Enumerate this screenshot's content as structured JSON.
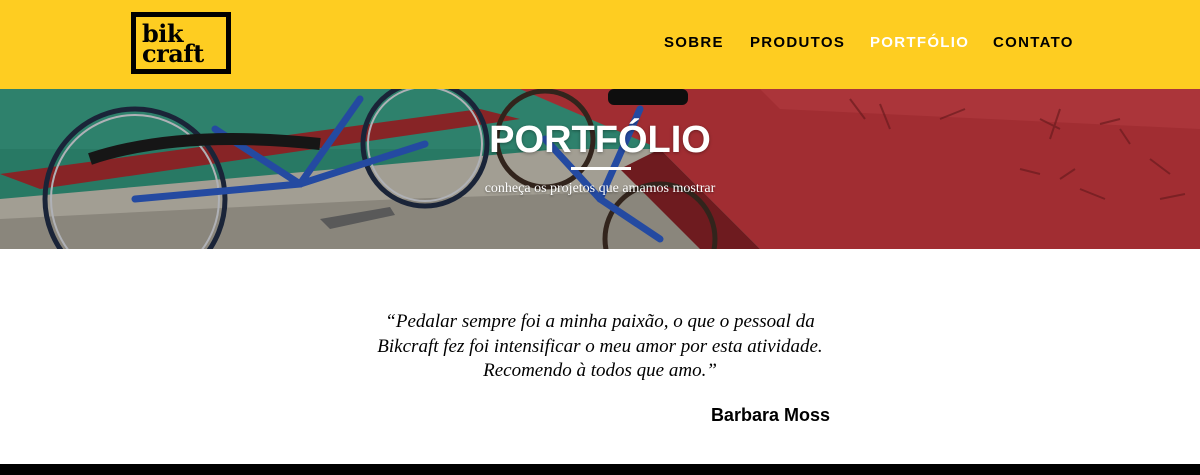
{
  "logo": {
    "line1": "bik",
    "line2": "craft"
  },
  "nav": {
    "items": [
      {
        "label": "SOBRE",
        "active": false
      },
      {
        "label": "PRODUTOS",
        "active": false
      },
      {
        "label": "PORTFÓLIO",
        "active": true
      },
      {
        "label": "CONTATO",
        "active": false
      }
    ]
  },
  "hero": {
    "title": "PORTFÓLIO",
    "subtitle": "conheça os projetos que amamos mostrar",
    "background_icon": "bicycles-on-pier-photo"
  },
  "testimonial": {
    "quote": "“Pedalar sempre foi a minha paixão, o que o pessoal da Bikcraft fez foi intensificar o meu amor por esta atividade. Recomendo à todos que amo.”",
    "author": "Barbara Moss"
  },
  "colors": {
    "brand_yellow": "#fecd21",
    "text": "#000000",
    "footer": "#000000"
  }
}
